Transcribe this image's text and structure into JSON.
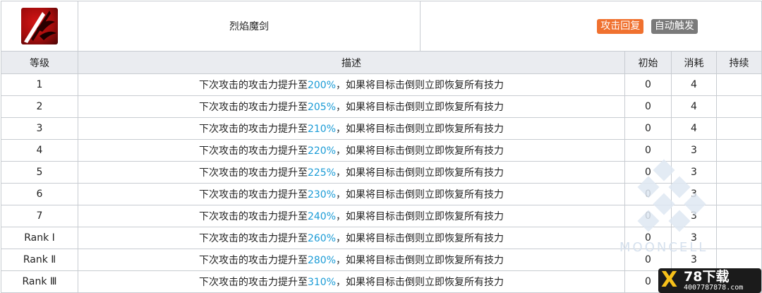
{
  "skill": {
    "name": "烈焰魔剑",
    "icon": "flame-sword-icon",
    "tags": [
      {
        "label": "攻击回复",
        "color": "#f0712f"
      },
      {
        "label": "自动触发",
        "color": "#7a7a7a"
      }
    ]
  },
  "columns": {
    "level": "等级",
    "description": "描述",
    "initial": "初始",
    "cost": "消耗",
    "duration": "持续"
  },
  "rows": [
    {
      "level": "1",
      "desc_before": "下次攻击的攻击力提升至",
      "value": "200%",
      "desc_after": "，如果将目标击倒则立即恢复所有技力",
      "initial": "0",
      "cost": "4",
      "duration": ""
    },
    {
      "level": "2",
      "desc_before": "下次攻击的攻击力提升至",
      "value": "205%",
      "desc_after": "，如果将目标击倒则立即恢复所有技力",
      "initial": "0",
      "cost": "4",
      "duration": ""
    },
    {
      "level": "3",
      "desc_before": "下次攻击的攻击力提升至",
      "value": "210%",
      "desc_after": "，如果将目标击倒则立即恢复所有技力",
      "initial": "0",
      "cost": "4",
      "duration": ""
    },
    {
      "level": "4",
      "desc_before": "下次攻击的攻击力提升至",
      "value": "220%",
      "desc_after": "，如果将目标击倒则立即恢复所有技力",
      "initial": "0",
      "cost": "3",
      "duration": ""
    },
    {
      "level": "5",
      "desc_before": "下次攻击的攻击力提升至",
      "value": "225%",
      "desc_after": "，如果将目标击倒则立即恢复所有技力",
      "initial": "0",
      "cost": "3",
      "duration": ""
    },
    {
      "level": "6",
      "desc_before": "下次攻击的攻击力提升至",
      "value": "230%",
      "desc_after": "，如果将目标击倒则立即恢复所有技力",
      "initial": "0",
      "cost": "3",
      "duration": ""
    },
    {
      "level": "7",
      "desc_before": "下次攻击的攻击力提升至",
      "value": "240%",
      "desc_after": "，如果将目标击倒则立即恢复所有技力",
      "initial": "0",
      "cost": "3",
      "duration": ""
    },
    {
      "level": "Rank Ⅰ",
      "desc_before": "下次攻击的攻击力提升至",
      "value": "260%",
      "desc_after": "，如果将目标击倒则立即恢复所有技力",
      "initial": "0",
      "cost": "3",
      "duration": ""
    },
    {
      "level": "Rank Ⅱ",
      "desc_before": "下次攻击的攻击力提升至",
      "value": "280%",
      "desc_after": "，如果将目标击倒则立即恢复所有技力",
      "initial": "0",
      "cost": "3",
      "duration": ""
    },
    {
      "level": "Rank Ⅲ",
      "desc_before": "下次攻击的攻击力提升至",
      "value": "310%",
      "desc_after": "，如果将目标击倒则立即恢复所有技力",
      "initial": "0",
      "cost": "3",
      "duration": ""
    }
  ],
  "watermark": {
    "text": "MOONCELL"
  },
  "logo": {
    "mark": "X",
    "title": "78下载",
    "phone": "4007787878.com"
  },
  "colors": {
    "highlight": "#1a9bd6",
    "header_bg": "#eaecf0",
    "border": "#c8ccd1"
  }
}
